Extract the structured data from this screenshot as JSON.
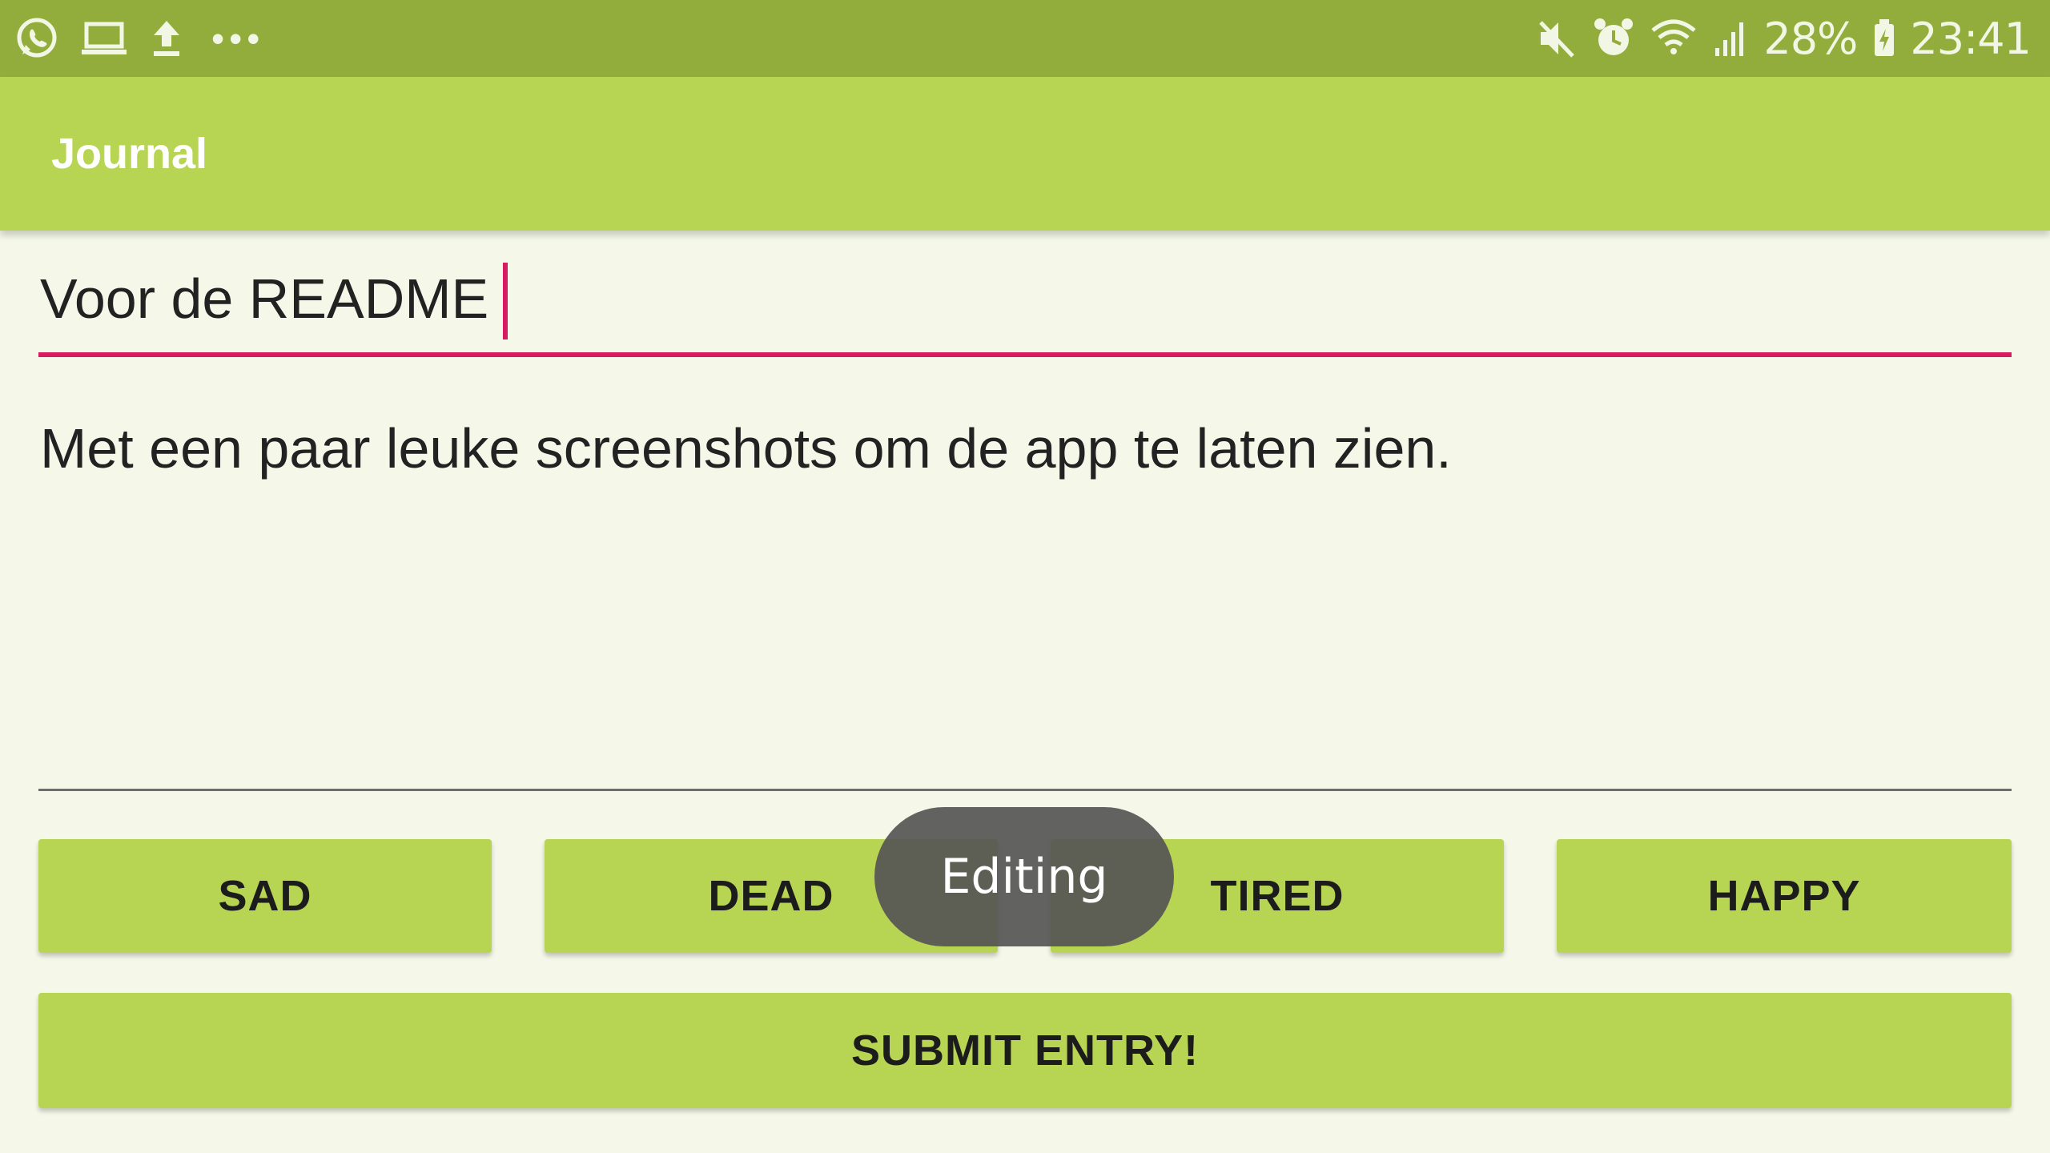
{
  "status_bar": {
    "left_icons": [
      "whatsapp-icon",
      "laptop-icon",
      "upload-icon",
      "more-dots-icon"
    ],
    "more_dots": "•••",
    "right_icons": [
      "mute-icon",
      "alarm-icon",
      "wifi-icon",
      "signal-icon",
      "battery-icon"
    ],
    "battery": "28%",
    "time": "23:41",
    "background_color": "#93ad3c"
  },
  "app_bar": {
    "title": "Journal",
    "background_color": "#b8d453"
  },
  "entry": {
    "title_value": "Voor de README",
    "body_value": "Met een paar leuke screenshots om de app te laten zien.",
    "accent_color": "#d81b60"
  },
  "mood_buttons": [
    {
      "label": "SAD"
    },
    {
      "label": "DEAD"
    },
    {
      "label": "TIRED"
    },
    {
      "label": "HAPPY"
    }
  ],
  "submit_button": {
    "label": "SUBMIT ENTRY!"
  },
  "toast": {
    "text": "Editing"
  }
}
